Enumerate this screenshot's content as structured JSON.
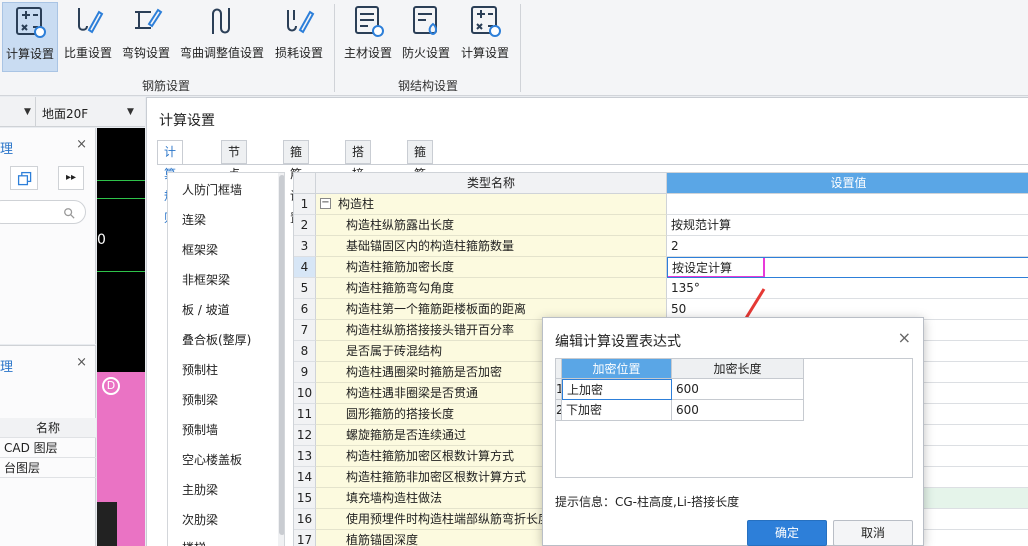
{
  "ribbon": {
    "rebar_group_label": "钢筋设置",
    "steel_group_label": "钢结构设置",
    "rebar_buttons": [
      {
        "label": "计算设置",
        "icon": "calc-settings-icon"
      },
      {
        "label": "比重设置",
        "icon": "weight-settings-icon"
      },
      {
        "label": "弯钩设置",
        "icon": "hook-settings-icon"
      },
      {
        "label": "弯曲调整值设置",
        "icon": "bend-adjust-icon"
      },
      {
        "label": "损耗设置",
        "icon": "loss-settings-icon"
      }
    ],
    "steel_buttons": [
      {
        "label": "主材设置",
        "icon": "main-material-icon"
      },
      {
        "label": "防火设置",
        "icon": "fireproof-icon"
      },
      {
        "label": "计算设置",
        "icon": "steel-calc-icon"
      }
    ]
  },
  "floorbar": {
    "floor": "地面20F"
  },
  "left_panels": {
    "panel1_title": "理",
    "panel2_title": "理",
    "close": "×",
    "layers_header": "名称",
    "layers": [
      "CAD 图层",
      "台图层"
    ]
  },
  "canvas": {
    "digit": "0",
    "marker": "D"
  },
  "dialog": {
    "title": "计算设置",
    "tabs": [
      "计算规则",
      "节点设置",
      "箍筋设置",
      "搭接设置",
      "箍筋公式"
    ],
    "categories": [
      "人防门框墙",
      "连梁",
      "框架梁",
      "非框架梁",
      "板 / 坡道",
      "叠合板(整厚)",
      "预制柱",
      "预制梁",
      "预制墙",
      "空心楼盖板",
      "主肋梁",
      "次肋梁",
      "楼梯"
    ],
    "grid_header": {
      "name": "类型名称",
      "value": "设置值"
    },
    "rows": [
      {
        "num": "1",
        "name": "构造柱",
        "value": ""
      },
      {
        "num": "2",
        "name": "构造柱纵筋露出长度",
        "value": "按规范计算"
      },
      {
        "num": "3",
        "name": "基础锚固区内的构造柱箍筋数量",
        "value": "2"
      },
      {
        "num": "4",
        "name": "构造柱箍筋加密长度",
        "value": "按设定计算"
      },
      {
        "num": "5",
        "name": "构造柱箍筋弯勾角度",
        "value": "135°"
      },
      {
        "num": "6",
        "name": "构造柱第一个箍筋距楼板面的距离",
        "value": "50"
      },
      {
        "num": "7",
        "name": "构造柱纵筋搭接接头错开百分率",
        "value": ""
      },
      {
        "num": "8",
        "name": "是否属于砖混结构",
        "value": ""
      },
      {
        "num": "9",
        "name": "构造柱遇圈梁时箍筋是否加密",
        "value": ""
      },
      {
        "num": "10",
        "name": "构造柱遇非圈梁是否贯通",
        "value": ""
      },
      {
        "num": "11",
        "name": "圆形箍筋的搭接长度",
        "value": ""
      },
      {
        "num": "12",
        "name": "螺旋箍筋是否连续通过",
        "value": ""
      },
      {
        "num": "13",
        "name": "构造柱箍筋加密区根数计算方式",
        "value": ""
      },
      {
        "num": "14",
        "name": "构造柱箍筋非加密区根数计算方式",
        "value": ""
      },
      {
        "num": "15",
        "name": "填充墙构造柱做法",
        "value": ""
      },
      {
        "num": "16",
        "name": "使用预埋件时构造柱端部纵筋弯折长度",
        "value": ""
      },
      {
        "num": "17",
        "name": "植筋锚固深度",
        "value": ""
      }
    ]
  },
  "exp_dialog": {
    "title": "编辑计算设置表达式",
    "close": "×",
    "col_position": "加密位置",
    "col_length": "加密长度",
    "rows": [
      {
        "num": "1",
        "position": "上加密",
        "length": "600"
      },
      {
        "num": "2",
        "position": "下加密",
        "length": "600"
      }
    ],
    "hint": "提示信息：CG-柱高度,Li-搭接长度",
    "ok": "确定",
    "cancel": "取消"
  },
  "colors": {
    "accent": "#2d7fd9",
    "highlight_box": "#e83ad9",
    "arrow": "#e53935",
    "name_col_bg": "#fcfadf",
    "value_header_bg": "#5aa6e6"
  }
}
